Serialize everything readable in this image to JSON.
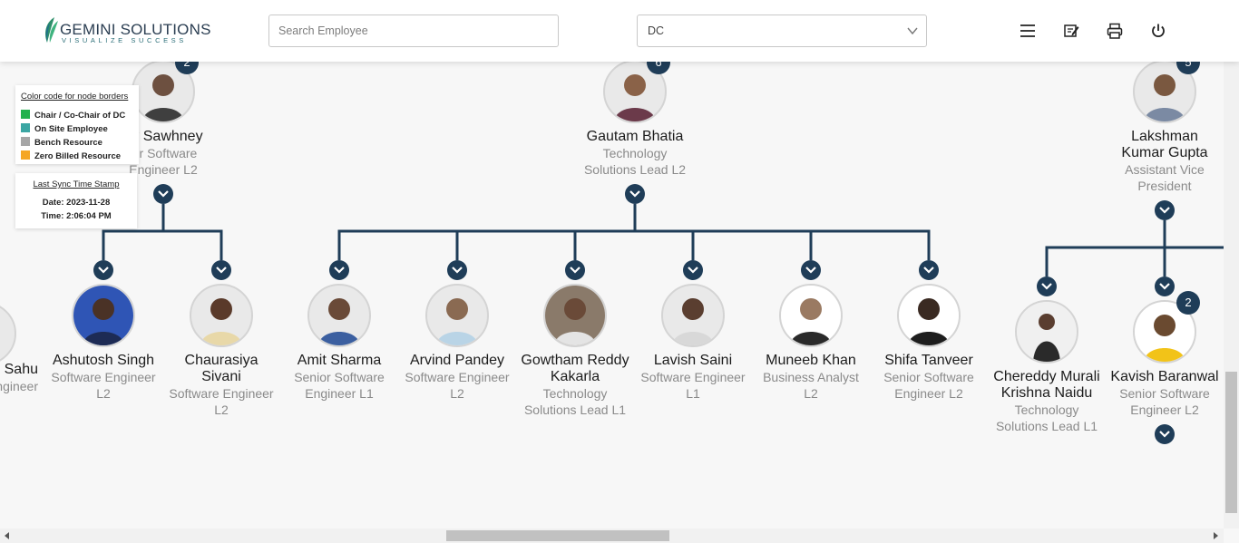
{
  "header": {
    "logo_main": "GEMINI SOLUTIONS",
    "logo_sub": "VISUALIZE SUCCESS",
    "search_placeholder": "Search Employee",
    "filter_value": "DC",
    "icons": [
      "menu-icon",
      "report-icon",
      "print-icon",
      "power-icon"
    ]
  },
  "legend": {
    "title": "Color code for node borders",
    "items": [
      {
        "label": "Chair / Co-Chair of DC",
        "color": "#22b14c"
      },
      {
        "label": "On Site Employee",
        "color": "#3ba6a3"
      },
      {
        "label": "Bench Resource",
        "color": "#a6a6a6"
      },
      {
        "label": "Zero Billed Resource",
        "color": "#f5a623"
      }
    ]
  },
  "sync": {
    "title": "Last Sync Time Stamp",
    "date": "Date: 2023-11-28",
    "time": "Time: 2:06:04 PM"
  },
  "colors": {
    "connector": "#1f3d58",
    "badge": "#1f3d58",
    "name": "#1c1c1c",
    "role": "#8a8a8a"
  },
  "nodes": {
    "vsawhney": {
      "name": "av Sawhney",
      "role_l1": "ior Software",
      "role_l2": "Engineer L2",
      "badge": "2"
    },
    "gautam": {
      "name": "Gautam Bhatia",
      "role_l1": "Technology",
      "role_l2": "Solutions Lead L2",
      "badge": "6"
    },
    "lakshman": {
      "name_l1": "Lakshman",
      "name_l2": "Kumar Gupta",
      "role_l1": "Assistant Vice",
      "role_l2": "President",
      "badge": "5"
    },
    "sahu": {
      "name": "Sahu",
      "role_l1": "ngineer"
    },
    "ashutosh": {
      "name": "Ashutosh Singh",
      "role_l1": "Software Engineer",
      "role_l2": "L2"
    },
    "chaurasiya": {
      "name_l1": "Chaurasiya",
      "name_l2": "Sivani",
      "role_l1": "Software Engineer",
      "role_l2": "L2"
    },
    "amit": {
      "name": "Amit Sharma",
      "role_l1": "Senior Software",
      "role_l2": "Engineer L1"
    },
    "arvind": {
      "name": "Arvind Pandey",
      "role_l1": "Software Engineer",
      "role_l2": "L2"
    },
    "gowtham": {
      "name_l1": "Gowtham Reddy",
      "name_l2": "Kakarla",
      "role_l1": "Technology",
      "role_l2": "Solutions Lead L1"
    },
    "lavish": {
      "name": "Lavish Saini",
      "role_l1": "Software Engineer",
      "role_l2": "L1"
    },
    "muneeb": {
      "name": "Muneeb Khan",
      "role_l1": "Business Analyst",
      "role_l2": "L2"
    },
    "shifa": {
      "name": "Shifa Tanveer",
      "role_l1": "Senior Software",
      "role_l2": "Engineer L2"
    },
    "chereddy": {
      "name_l1": "Chereddy Murali",
      "name_l2": "Krishna Naidu",
      "role_l1": "Technology",
      "role_l2": "Solutions Lead L1"
    },
    "kavish": {
      "name": "Kavish Baranwal",
      "role_l1": "Senior Software",
      "role_l2": "Engineer L2",
      "badge": "2"
    }
  }
}
